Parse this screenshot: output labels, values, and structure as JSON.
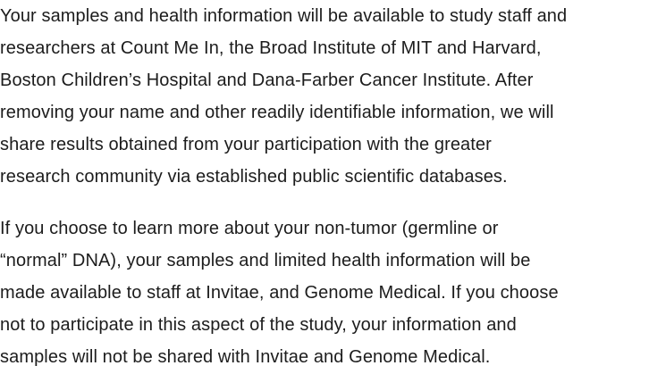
{
  "document": {
    "paragraphs": [
      {
        "lines": [
          "Your samples and health information will be available to study staff and",
          "researchers at Count Me In, the Broad Institute of MIT and Harvard,",
          "Boston Children’s Hospital and Dana-Farber Cancer Institute. After",
          "removing your name and other readily identifiable information, we will",
          "share results obtained from your participation with the greater",
          "research community via established public scientific databases."
        ]
      },
      {
        "lines": [
          "If you choose to learn more about your non-tumor (germline or",
          "“normal” DNA), your samples and limited health information will be",
          "made available to staff at Invitae, and Genome Medical. If you choose",
          "not to participate in this aspect of the study, your information and",
          "samples will not be shared with Invitae and Genome Medical."
        ]
      }
    ]
  }
}
